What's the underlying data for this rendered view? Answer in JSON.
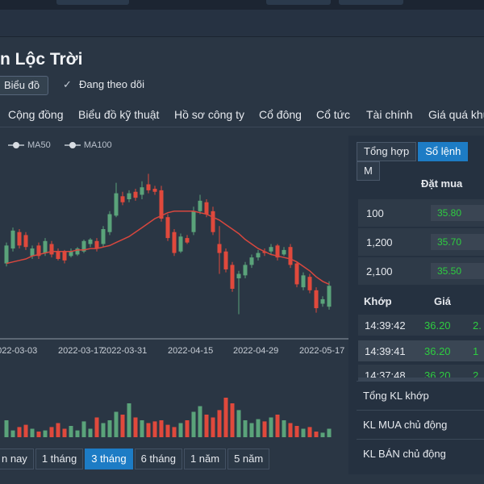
{
  "page": {
    "title": "n Lộc Trời",
    "chart_button": "Biểu đồ",
    "follow_label": "Đang theo dõi"
  },
  "nav": [
    "Cộng đồng",
    "Biểu đồ kỹ thuật",
    "Hồ sơ công ty",
    "Cổ đông",
    "Cổ tức",
    "Tài chính",
    "Giá quá khứ"
  ],
  "colors": {
    "up": "#5aa37a",
    "down": "#e0493c",
    "ma": "#d8473e",
    "accent": "#1d7cc5",
    "green_text": "#2ecc40"
  },
  "chart_data": {
    "type": "candlestick",
    "legend": [
      "MA50",
      "MA100"
    ],
    "x_tick_labels": [
      "2022-03-03",
      "2022-03-17",
      "2022-03-31",
      "2022-04-15",
      "2022-04-29",
      "2022-05-17"
    ],
    "candles": [
      {
        "o": 0.37,
        "c": 0.49,
        "h": 0.51,
        "l": 0.35
      },
      {
        "o": 0.47,
        "c": 0.59,
        "h": 0.61,
        "l": 0.45
      },
      {
        "o": 0.58,
        "c": 0.49,
        "h": 0.6,
        "l": 0.47
      },
      {
        "o": 0.56,
        "c": 0.48,
        "h": 0.58,
        "l": 0.46
      },
      {
        "o": 0.42,
        "c": 0.47,
        "h": 0.49,
        "l": 0.4
      },
      {
        "o": 0.49,
        "c": 0.42,
        "h": 0.51,
        "l": 0.4
      },
      {
        "o": 0.44,
        "c": 0.52,
        "h": 0.54,
        "l": 0.42
      },
      {
        "o": 0.5,
        "c": 0.43,
        "h": 0.52,
        "l": 0.41
      },
      {
        "o": 0.45,
        "c": 0.4,
        "h": 0.47,
        "l": 0.39
      },
      {
        "o": 0.45,
        "c": 0.39,
        "h": 0.46,
        "l": 0.37
      },
      {
        "o": 0.42,
        "c": 0.45,
        "h": 0.47,
        "l": 0.41
      },
      {
        "o": 0.43,
        "c": 0.47,
        "h": 0.48,
        "l": 0.42
      },
      {
        "o": 0.45,
        "c": 0.52,
        "h": 0.53,
        "l": 0.44
      },
      {
        "o": 0.5,
        "c": 0.53,
        "h": 0.54,
        "l": 0.48
      },
      {
        "o": 0.52,
        "c": 0.47,
        "h": 0.54,
        "l": 0.45
      },
      {
        "o": 0.5,
        "c": 0.6,
        "h": 0.62,
        "l": 0.48
      },
      {
        "o": 0.58,
        "c": 0.7,
        "h": 0.72,
        "l": 0.56
      },
      {
        "o": 0.69,
        "c": 0.84,
        "h": 0.91,
        "l": 0.68
      },
      {
        "o": 0.82,
        "c": 0.78,
        "h": 0.85,
        "l": 0.76
      },
      {
        "o": 0.8,
        "c": 0.84,
        "h": 0.86,
        "l": 0.78
      },
      {
        "o": 0.85,
        "c": 0.81,
        "h": 0.87,
        "l": 0.79
      },
      {
        "o": 0.83,
        "c": 0.88,
        "h": 0.92,
        "l": 0.8
      },
      {
        "o": 0.9,
        "c": 0.86,
        "h": 0.97,
        "l": 0.84
      },
      {
        "o": 0.87,
        "c": 0.85,
        "h": 0.89,
        "l": 0.83
      },
      {
        "o": 0.86,
        "c": 0.67,
        "h": 0.89,
        "l": 0.65
      },
      {
        "o": 0.68,
        "c": 0.54,
        "h": 0.7,
        "l": 0.52
      },
      {
        "o": 0.58,
        "c": 0.44,
        "h": 0.6,
        "l": 0.42
      },
      {
        "o": 0.45,
        "c": 0.55,
        "h": 0.57,
        "l": 0.44
      },
      {
        "o": 0.54,
        "c": 0.51,
        "h": 0.56,
        "l": 0.5
      },
      {
        "o": 0.58,
        "c": 0.72,
        "h": 0.75,
        "l": 0.56
      },
      {
        "o": 0.72,
        "c": 0.79,
        "h": 0.83,
        "l": 0.7
      },
      {
        "o": 0.78,
        "c": 0.7,
        "h": 0.8,
        "l": 0.68
      },
      {
        "o": 0.72,
        "c": 0.58,
        "h": 0.75,
        "l": 0.56
      },
      {
        "o": 0.5,
        "c": 0.44,
        "h": 0.62,
        "l": 0.3
      },
      {
        "o": 0.45,
        "c": 0.33,
        "h": 0.47,
        "l": 0.31
      },
      {
        "o": 0.36,
        "c": 0.2,
        "h": 0.38,
        "l": 0.18
      },
      {
        "o": 0.27,
        "c": 0.3,
        "h": 0.32,
        "l": 0.03
      },
      {
        "o": 0.29,
        "c": 0.36,
        "h": 0.38,
        "l": 0.27
      },
      {
        "o": 0.36,
        "c": 0.41,
        "h": 0.43,
        "l": 0.34
      },
      {
        "o": 0.41,
        "c": 0.44,
        "h": 0.46,
        "l": 0.39
      },
      {
        "o": 0.45,
        "c": 0.44,
        "h": 0.47,
        "l": 0.42
      },
      {
        "o": 0.45,
        "c": 0.48,
        "h": 0.5,
        "l": 0.43
      },
      {
        "o": 0.49,
        "c": 0.41,
        "h": 0.5,
        "l": 0.39
      },
      {
        "o": 0.43,
        "c": 0.46,
        "h": 0.48,
        "l": 0.42
      },
      {
        "o": 0.48,
        "c": 0.36,
        "h": 0.5,
        "l": 0.34
      },
      {
        "o": 0.37,
        "c": 0.23,
        "h": 0.38,
        "l": 0.21
      },
      {
        "o": 0.21,
        "c": 0.29,
        "h": 0.31,
        "l": 0.19
      },
      {
        "o": 0.28,
        "c": 0.19,
        "h": 0.3,
        "l": 0.17
      },
      {
        "o": 0.19,
        "c": 0.07,
        "h": 0.21,
        "l": 0.04
      },
      {
        "o": 0.1,
        "c": 0.13,
        "h": 0.15,
        "l": 0.08
      },
      {
        "o": 0.08,
        "c": 0.22,
        "h": 0.25,
        "l": 0.06
      }
    ],
    "ma": [
      0.37,
      0.38,
      0.39,
      0.4,
      0.42,
      0.43,
      0.44,
      0.45,
      0.45,
      0.45,
      0.45,
      0.46,
      0.46,
      0.47,
      0.47,
      0.48,
      0.49,
      0.51,
      0.53,
      0.55,
      0.58,
      0.61,
      0.64,
      0.67,
      0.69,
      0.71,
      0.72,
      0.72,
      0.72,
      0.72,
      0.71,
      0.7,
      0.68,
      0.66,
      0.63,
      0.6,
      0.57,
      0.53,
      0.5,
      0.47,
      0.45,
      0.43,
      0.42,
      0.41,
      0.4,
      0.38,
      0.35,
      0.32,
      0.28,
      0.25,
      0.23
    ],
    "volumes": [
      0.3,
      0.12,
      0.18,
      0.22,
      0.15,
      0.1,
      0.12,
      0.18,
      0.25,
      0.15,
      0.2,
      0.12,
      0.28,
      0.15,
      0.35,
      0.25,
      0.3,
      0.45,
      0.4,
      0.6,
      0.35,
      0.3,
      0.25,
      0.28,
      0.3,
      0.22,
      0.18,
      0.25,
      0.3,
      0.45,
      0.55,
      0.4,
      0.35,
      0.48,
      0.7,
      0.6,
      0.48,
      0.3,
      0.25,
      0.32,
      0.28,
      0.35,
      0.4,
      0.3,
      0.25,
      0.2,
      0.15,
      0.18,
      0.1,
      0.08,
      0.15
    ]
  },
  "periods": [
    "n nay",
    "1 tháng",
    "3 tháng",
    "6 tháng",
    "1 năm",
    "5 năm"
  ],
  "tabs": [
    "Tổng hợp",
    "Sổ lệnh",
    "M"
  ],
  "order_book": {
    "header": "Đặt mua",
    "rows": [
      {
        "qty": "100",
        "price": "35.80"
      },
      {
        "qty": "1,200",
        "price": "35.70"
      },
      {
        "qty": "2,100",
        "price": "35.50"
      }
    ]
  },
  "trades": {
    "header_time": "Khớp",
    "header_price": "Giá",
    "rows": [
      {
        "time": "14:39:42",
        "price": "36.20",
        "vol": "2."
      },
      {
        "time": "14:39:41",
        "price": "36.20",
        "vol": "1"
      },
      {
        "time": "14:37:48",
        "price": "36.20",
        "vol": "2."
      }
    ]
  },
  "summary": [
    "Tổng KL khớp",
    "KL MUA chủ động",
    "KL BÁN chủ động"
  ]
}
